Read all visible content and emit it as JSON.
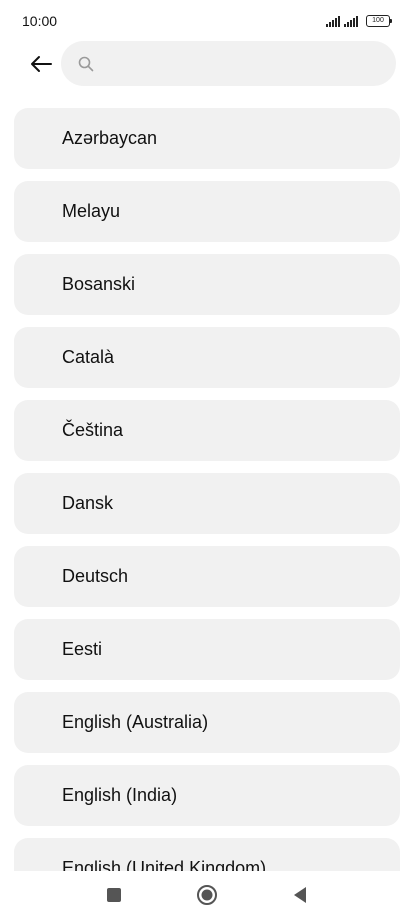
{
  "status_bar": {
    "time": "10:00",
    "battery": "100"
  },
  "search": {
    "placeholder": "",
    "value": ""
  },
  "languages": [
    {
      "label": "Azərbaycan"
    },
    {
      "label": "Melayu"
    },
    {
      "label": "Bosanski"
    },
    {
      "label": "Català"
    },
    {
      "label": "Čeština"
    },
    {
      "label": "Dansk"
    },
    {
      "label": "Deutsch"
    },
    {
      "label": "Eesti"
    },
    {
      "label": "English (Australia)"
    },
    {
      "label": "English (India)"
    },
    {
      "label": "English (United Kingdom)"
    }
  ],
  "icons": {
    "back": "arrow-left-icon",
    "search": "search-icon",
    "nav_recents": "square-icon",
    "nav_home": "circle-icon",
    "nav_back": "triangle-left-icon"
  },
  "colors": {
    "item_background": "#f1f1f1",
    "page_background": "#ffffff",
    "text": "#111111"
  }
}
